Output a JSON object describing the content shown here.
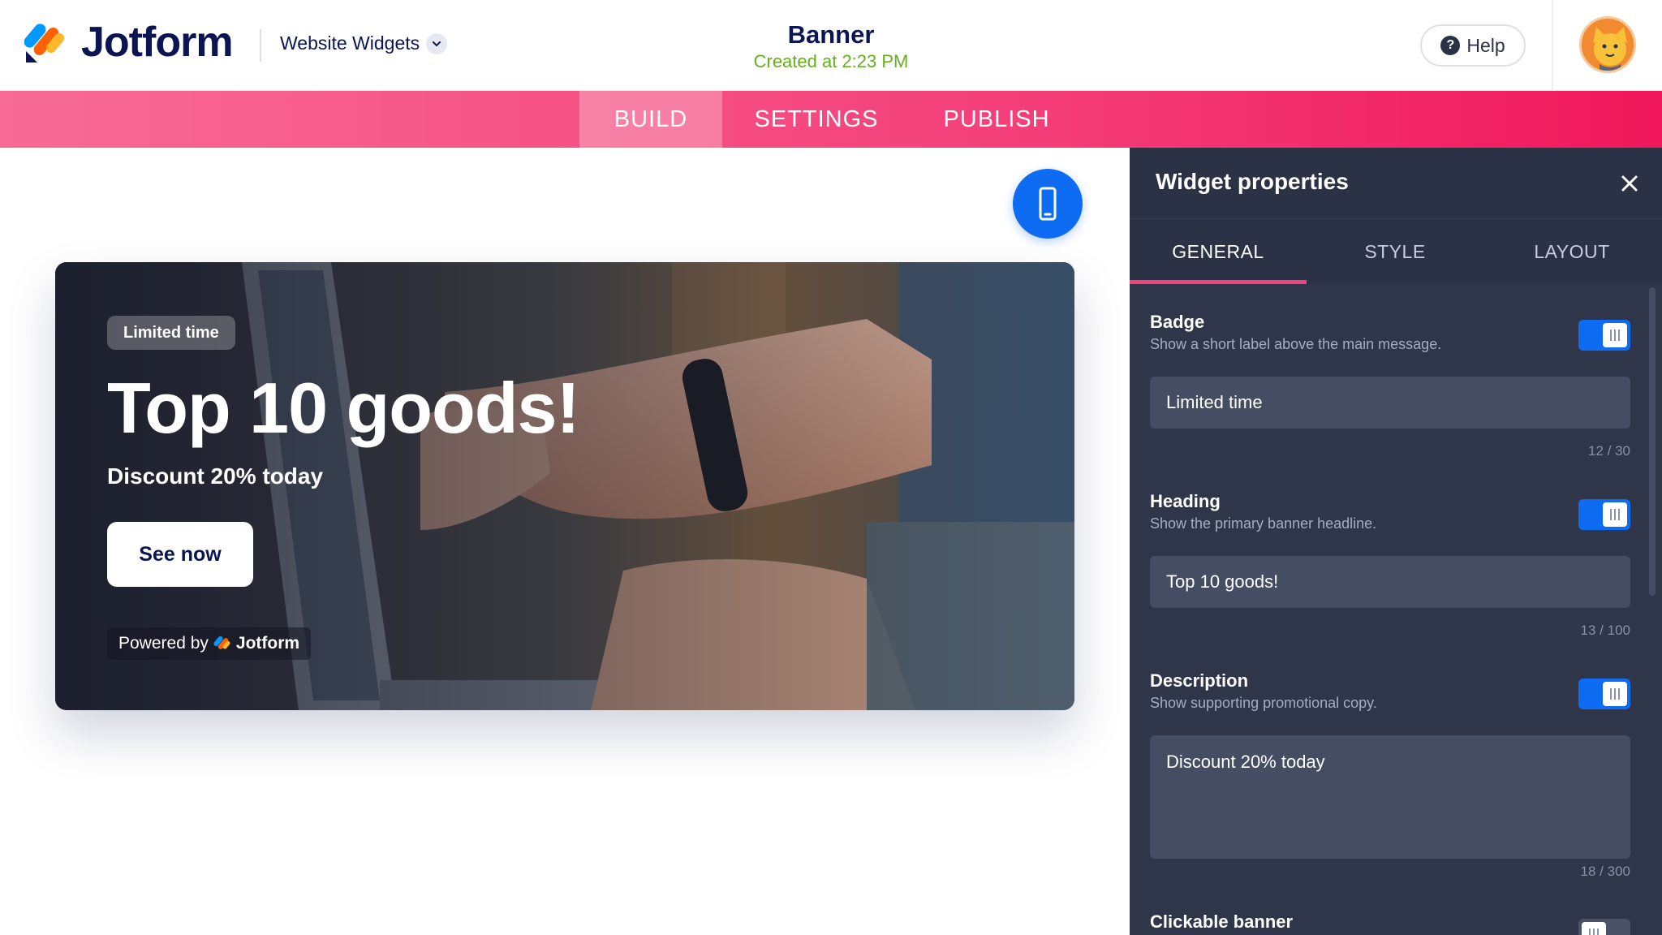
{
  "header": {
    "brand": "Jotform",
    "dropdown_label": "Website Widgets",
    "title": "Banner",
    "subtitle": "Created at 2:23 PM",
    "help_label": "Help"
  },
  "nav": {
    "tabs": [
      {
        "label": "BUILD",
        "active": true
      },
      {
        "label": "SETTINGS",
        "active": false
      },
      {
        "label": "PUBLISH",
        "active": false
      }
    ]
  },
  "canvas": {
    "device_icon": "mobile-phone-icon",
    "banner": {
      "badge": "Limited time",
      "heading": "Top 10 goods!",
      "description": "Discount 20% today",
      "cta_label": "See now",
      "powered_prefix": "Powered by",
      "powered_brand": "Jotform"
    }
  },
  "panel": {
    "title": "Widget properties",
    "tabs": [
      {
        "label": "GENERAL",
        "active": true
      },
      {
        "label": "STYLE",
        "active": false
      },
      {
        "label": "LAYOUT",
        "active": false
      }
    ],
    "properties": [
      {
        "title": "Badge",
        "subtitle": "Show a short label above the main message.",
        "enabled": true,
        "value": "Limited time",
        "counter": "12 / 30"
      },
      {
        "title": "Heading",
        "subtitle": "Show the primary banner headline.",
        "enabled": true,
        "value": "Top 10 goods!",
        "counter": "13 / 100"
      },
      {
        "title": "Description",
        "subtitle": "Show supporting promotional copy.",
        "enabled": true,
        "value": "Discount 20% today",
        "counter": "18 / 300"
      },
      {
        "title": "Clickable banner",
        "enabled": false
      }
    ]
  },
  "colors": {
    "brand_navy": "#0a1551",
    "accent_pink": "#f4407a",
    "toggle_blue": "#0d6cf2",
    "panel_bg": "#2b3245",
    "timestamp_green": "#64b21b"
  }
}
